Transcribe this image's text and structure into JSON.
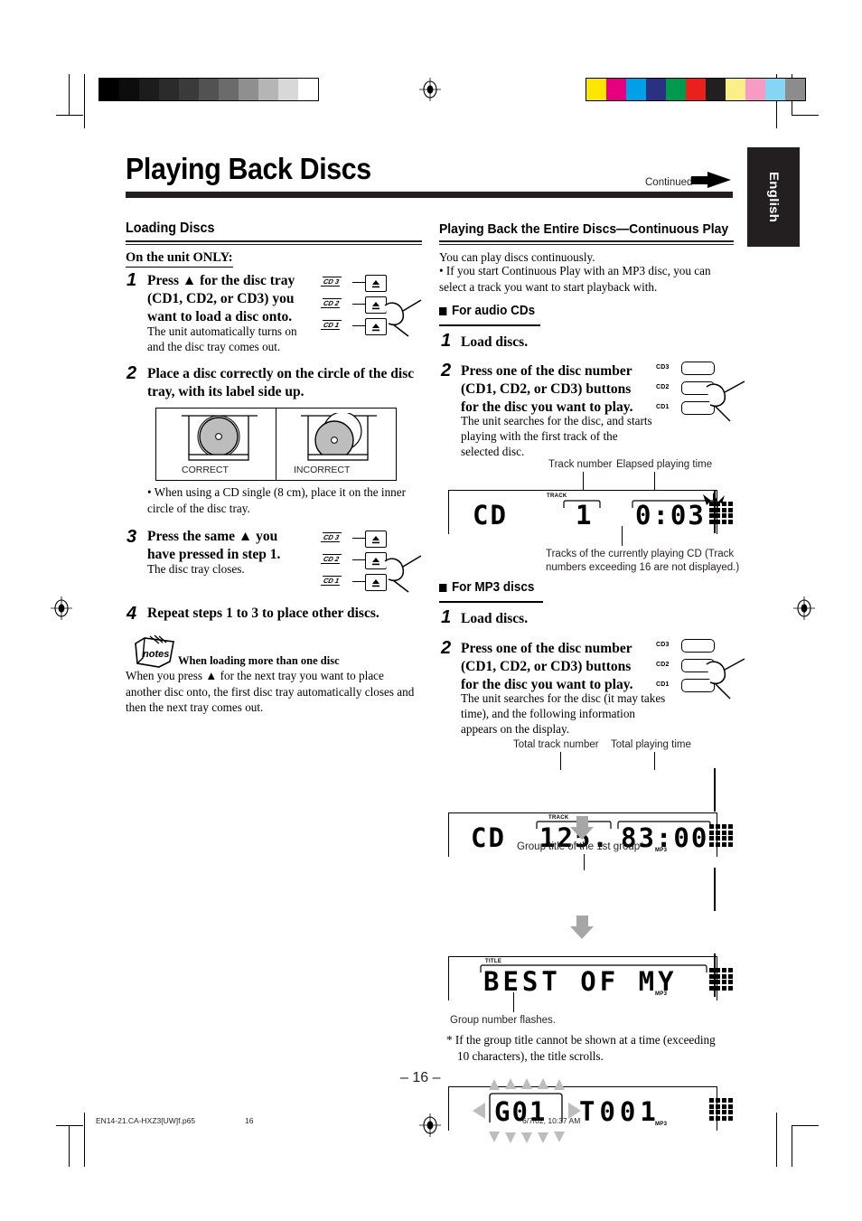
{
  "page": {
    "title": "Playing Back Discs",
    "continued_label": "Continued",
    "language_tab": "English",
    "page_number": "– 16 –"
  },
  "footer": {
    "filename": "EN14-21.CA-HXZ3[UW]f.p65",
    "folio": "16",
    "timestamp": "6/7/02, 10:37 AM"
  },
  "color_bars": {
    "grayscale": [
      "#000000",
      "#0d0d0d",
      "#1c1c1c",
      "#2b2b2b",
      "#3b3b3b",
      "#525252",
      "#6b6b6b",
      "#8f8f8f",
      "#b5b5b5",
      "#d8d8d8",
      "#ffffff"
    ],
    "colors": [
      "#ffe600",
      "#e6007e",
      "#00a0e9",
      "#2b3180",
      "#009a4e",
      "#e8211c",
      "#231f20",
      "#fbef8a",
      "#f59bc4",
      "#87d5f5",
      "#8c8c8c"
    ]
  },
  "left_column": {
    "section_heading": "Loading Discs",
    "intro": "On the unit ONLY:",
    "steps": [
      {
        "num": "1",
        "bold": "Press ▲ for the disc tray (CD1, CD2, or CD3) you want to load a disc onto.",
        "body": "The unit automatically turns on and the disc tray comes out."
      },
      {
        "num": "2",
        "bold": "Place a disc correctly on the circle of the disc tray, with its label side up.",
        "body": ""
      },
      {
        "num": "3",
        "bold": "Press the same ▲ you have pressed in step 1.",
        "body": "The disc tray closes."
      },
      {
        "num": "4",
        "bold": "Repeat steps 1 to 3 to place other discs.",
        "body": ""
      }
    ],
    "tray_diagram": {
      "correct_label": "CORRECT",
      "incorrect_label": "INCORRECT"
    },
    "cd_single_note": "• When using a CD single (8 cm), place it on the inner circle of the disc tray.",
    "notes_icon_label": "notes",
    "notes_heading": "When loading more than one disc",
    "notes_body": "When you press ▲ for the next tray you want to place another disc onto, the first disc tray automatically closes and then the next tray comes out.",
    "tray_tags": [
      "CD 3",
      "CD 2",
      "CD 1"
    ]
  },
  "right_column": {
    "section_heading": "Playing Back the Entire Discs—Continuous Play",
    "intro_line1": "You can play discs continuously.",
    "intro_bullet": "• If you start Continuous Play with an MP3 disc, you can select a track you want to start playback with.",
    "audio_cds": {
      "subhead": "For audio CDs",
      "steps": [
        {
          "num": "1",
          "bold": "Load discs.",
          "body": ""
        },
        {
          "num": "2",
          "bold": "Press one of the disc number (CD1, CD2, or CD3) buttons for the disc you want to play.",
          "body": "The unit searches for the disc, and starts playing with the first track of the selected disc."
        }
      ],
      "button_labels": [
        "CD3",
        "CD2",
        "CD1"
      ],
      "callout_track": "Track number",
      "callout_time": "Elapsed playing time",
      "callout_matrix": "Tracks of the currently playing CD (Track numbers exceeding 16 are not displayed.)",
      "display": {
        "disc": "CD",
        "track_tag": "TRACK",
        "track": "1",
        "time": "0:03"
      }
    },
    "mp3_discs": {
      "subhead": "For MP3 discs",
      "steps": [
        {
          "num": "1",
          "bold": "Load discs.",
          "body": ""
        },
        {
          "num": "2",
          "bold": "Press one of the disc number (CD1, CD2, or CD3) buttons for the disc you want to play.",
          "body": "The unit searches for the disc (it may takes time), and the following information appears on the display."
        }
      ],
      "button_labels": [
        "CD3",
        "CD2",
        "CD1"
      ],
      "callout_total_tracks": "Total track number",
      "callout_total_time": "Total playing time",
      "callout_group_title": "Group title of the 1st group*",
      "callout_group_flash": "Group number flashes.",
      "footnote": "* If the group title cannot be shown at a time (exceeding 10 characters), the title scrolls.",
      "display1": {
        "disc": "CD",
        "track_tag": "TRACK",
        "tracks": "125.",
        "time": "83:00",
        "mp3_tag": "MP3"
      },
      "display2": {
        "title_tag": "TITLE",
        "text": "BEST OF MY",
        "mp3_tag": "MP3"
      },
      "display3": {
        "group": "G01",
        "track": "T001",
        "mp3_tag": "MP3"
      }
    }
  }
}
